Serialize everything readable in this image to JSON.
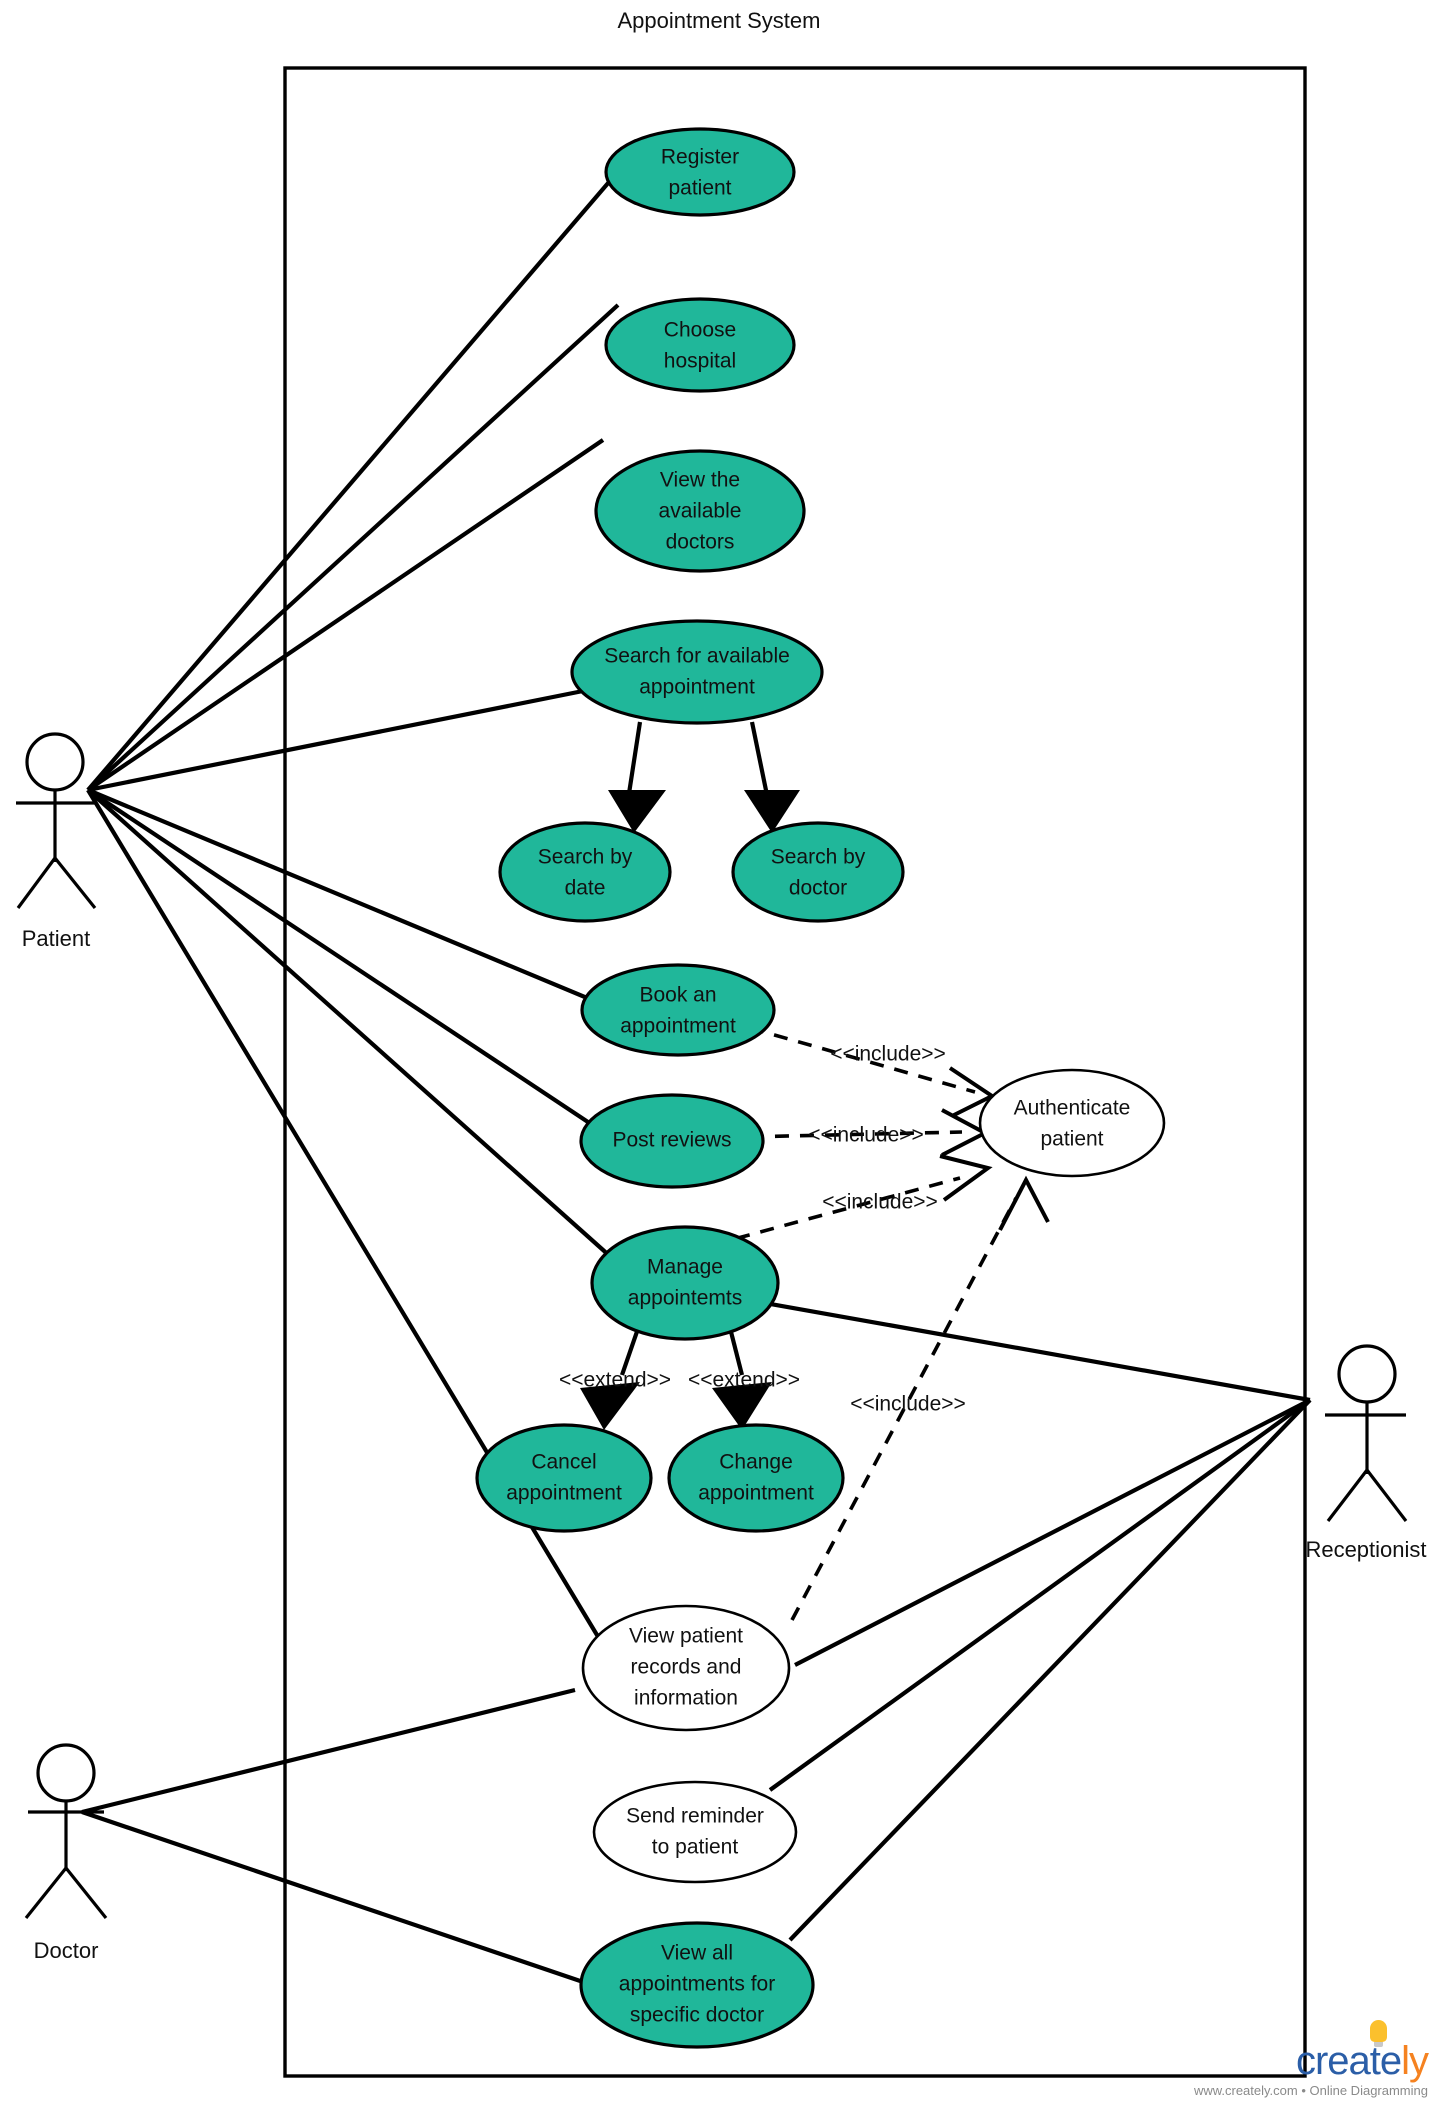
{
  "diagram": {
    "type": "uml-use-case-diagram",
    "system_title": "Appointment System",
    "accent_color": "#20B79A",
    "boundary_color": "#000000",
    "actors": [
      {
        "id": "patient",
        "label": "Patient"
      },
      {
        "id": "receptionist",
        "label": "Receptionist"
      },
      {
        "id": "doctor",
        "label": "Doctor"
      }
    ],
    "use_cases": [
      {
        "id": "register_patient",
        "label_lines": [
          "Register",
          "patient"
        ],
        "fill": "#20B79A"
      },
      {
        "id": "choose_hospital",
        "label_lines": [
          "Choose",
          "hospital"
        ],
        "fill": "#20B79A"
      },
      {
        "id": "view_available_doctors",
        "label_lines": [
          "View the",
          "available",
          "doctors"
        ],
        "fill": "#20B79A"
      },
      {
        "id": "search_available_appointment",
        "label_lines": [
          "Search for available",
          "appointment"
        ],
        "fill": "#20B79A"
      },
      {
        "id": "search_by_date",
        "label_lines": [
          "Search by",
          "date"
        ],
        "fill": "#20B79A"
      },
      {
        "id": "search_by_doctor",
        "label_lines": [
          "Search by",
          "doctor"
        ],
        "fill": "#20B79A"
      },
      {
        "id": "book_appointment",
        "label_lines": [
          "Book an",
          "appointment"
        ],
        "fill": "#20B79A"
      },
      {
        "id": "post_reviews",
        "label_lines": [
          "Post reviews"
        ],
        "fill": "#20B79A"
      },
      {
        "id": "authenticate_patient",
        "label_lines": [
          "Authenticate",
          "patient"
        ],
        "fill": "#FFFFFF"
      },
      {
        "id": "manage_appointemts",
        "label_lines": [
          "Manage",
          "appointemts"
        ],
        "fill": "#20B79A"
      },
      {
        "id": "cancel_appointment",
        "label_lines": [
          "Cancel",
          "appointment"
        ],
        "fill": "#20B79A"
      },
      {
        "id": "change_appointment",
        "label_lines": [
          "Change",
          "appointment"
        ],
        "fill": "#20B79A"
      },
      {
        "id": "view_patient_records",
        "label_lines": [
          "View patient",
          "records and",
          "information"
        ],
        "fill": "#FFFFFF"
      },
      {
        "id": "send_reminder",
        "label_lines": [
          "Send reminder",
          "to patient"
        ],
        "fill": "#FFFFFF"
      },
      {
        "id": "view_all_appointments_doctor",
        "label_lines": [
          "View all",
          "appointments for",
          "specific doctor"
        ],
        "fill": "#20B79A"
      }
    ],
    "stereotypes": [
      {
        "id": "include_book",
        "label": "<<include>>"
      },
      {
        "id": "include_post",
        "label": "<<include>>"
      },
      {
        "id": "include_manage",
        "label": "<<include>>"
      },
      {
        "id": "include_records",
        "label": "<<include>>"
      },
      {
        "id": "extend_cancel",
        "label": "<<extend>>"
      },
      {
        "id": "extend_change",
        "label": "<<extend>>"
      }
    ],
    "relationships": [
      {
        "from": "patient",
        "to": "register_patient",
        "kind": "association"
      },
      {
        "from": "patient",
        "to": "choose_hospital",
        "kind": "association"
      },
      {
        "from": "patient",
        "to": "view_available_doctors",
        "kind": "association"
      },
      {
        "from": "patient",
        "to": "search_available_appointment",
        "kind": "association"
      },
      {
        "from": "patient",
        "to": "book_appointment",
        "kind": "association"
      },
      {
        "from": "patient",
        "to": "post_reviews",
        "kind": "association"
      },
      {
        "from": "patient",
        "to": "manage_appointemts",
        "kind": "association"
      },
      {
        "from": "patient",
        "to": "view_patient_records",
        "kind": "association"
      },
      {
        "from": "search_available_appointment",
        "to": "search_by_date",
        "kind": "generalization"
      },
      {
        "from": "search_available_appointment",
        "to": "search_by_doctor",
        "kind": "generalization"
      },
      {
        "from": "book_appointment",
        "to": "authenticate_patient",
        "kind": "include"
      },
      {
        "from": "post_reviews",
        "to": "authenticate_patient",
        "kind": "include"
      },
      {
        "from": "manage_appointemts",
        "to": "authenticate_patient",
        "kind": "include"
      },
      {
        "from": "view_patient_records",
        "to": "authenticate_patient",
        "kind": "include"
      },
      {
        "from": "cancel_appointment",
        "to": "manage_appointemts",
        "kind": "extend"
      },
      {
        "from": "change_appointment",
        "to": "manage_appointemts",
        "kind": "extend"
      },
      {
        "from": "receptionist",
        "to": "manage_appointemts",
        "kind": "association"
      },
      {
        "from": "receptionist",
        "to": "view_patient_records",
        "kind": "association"
      },
      {
        "from": "receptionist",
        "to": "send_reminder",
        "kind": "association"
      },
      {
        "from": "receptionist",
        "to": "view_all_appointments_doctor",
        "kind": "association"
      },
      {
        "from": "doctor",
        "to": "view_patient_records",
        "kind": "association"
      },
      {
        "from": "doctor",
        "to": "view_all_appointments_doctor",
        "kind": "association"
      }
    ]
  },
  "watermark": {
    "brand_first": "create",
    "brand_second": "ly",
    "tagline": "www.creately.com • Online Diagramming",
    "brand_first_color": "#2B5EA7",
    "brand_second_color": "#F58220"
  }
}
